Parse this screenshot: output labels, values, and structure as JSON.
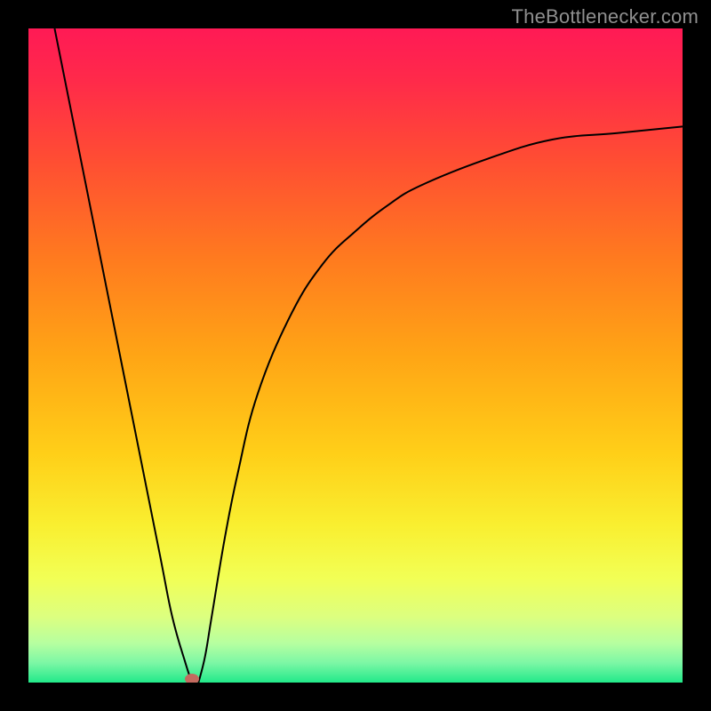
{
  "watermark": {
    "text": "TheBottlenecker.com"
  },
  "colors": {
    "marker": "#c46a5f",
    "curve": "#000000",
    "gradient_stops": [
      {
        "offset": "0%",
        "color": "#ff1a55"
      },
      {
        "offset": "8%",
        "color": "#ff2a4a"
      },
      {
        "offset": "20%",
        "color": "#ff4d33"
      },
      {
        "offset": "35%",
        "color": "#ff7a1f"
      },
      {
        "offset": "50%",
        "color": "#ffa515"
      },
      {
        "offset": "65%",
        "color": "#ffcf18"
      },
      {
        "offset": "76%",
        "color": "#f9ef30"
      },
      {
        "offset": "84%",
        "color": "#f2ff55"
      },
      {
        "offset": "90%",
        "color": "#dcff80"
      },
      {
        "offset": "94%",
        "color": "#b6ffa0"
      },
      {
        "offset": "97%",
        "color": "#7cf7a5"
      },
      {
        "offset": "100%",
        "color": "#22e98a"
      }
    ]
  },
  "chart_data": {
    "type": "line",
    "title": "",
    "xlabel": "",
    "ylabel": "",
    "xlim": [
      0,
      100
    ],
    "ylim": [
      0,
      100
    ],
    "note": "V-shaped curve with minimum near x≈25 y≈0; left limb nearly linear, right limb asymptotic toward ~85. Values estimated from pixels.",
    "marker": {
      "x": 25,
      "y": 0.5
    },
    "series": [
      {
        "name": "left-limb",
        "x": [
          4,
          8,
          12,
          16,
          20,
          22,
          24,
          25
        ],
        "values": [
          100,
          80,
          60,
          40,
          20,
          10,
          3,
          0
        ]
      },
      {
        "name": "right-limb",
        "x": [
          26,
          27,
          28,
          30,
          32,
          35,
          40,
          45,
          50,
          55,
          60,
          70,
          80,
          90,
          100
        ],
        "values": [
          0,
          4,
          10,
          22,
          32,
          44,
          56,
          64,
          69,
          73,
          76,
          80,
          83,
          84,
          85
        ]
      }
    ]
  }
}
